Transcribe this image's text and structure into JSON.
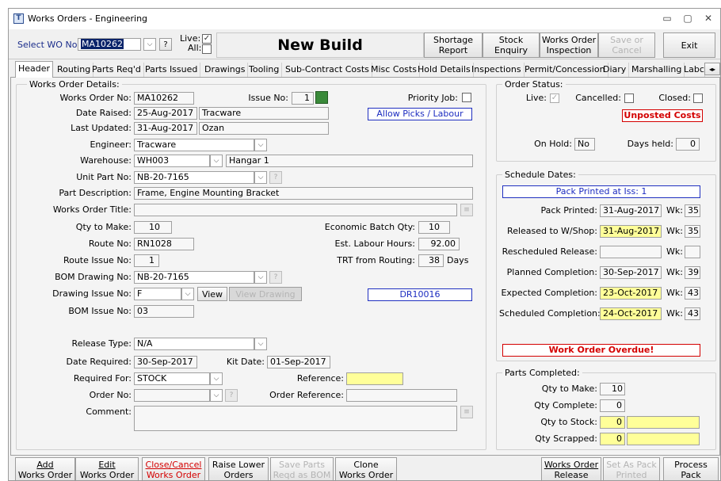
{
  "window": {
    "title": "Works Orders - Engineering",
    "min": "▭",
    "max": "▢",
    "close": "✕"
  },
  "toolbar": {
    "select_label": "Select WO No:",
    "wo_no": "MA10262",
    "help": "?",
    "live_label": "Live:",
    "all_label": "All:",
    "heading": "New Build",
    "shortage_report": [
      "Shortage",
      "Report"
    ],
    "stock_enquiry": [
      "Stock",
      "Enquiry"
    ],
    "wo_inspection": [
      "Works Order",
      "Inspection"
    ],
    "save_or_cancel": [
      "Save or",
      "Cancel"
    ],
    "exit": "Exit"
  },
  "tabs": [
    "Header",
    "Routing",
    "Parts Req'd",
    "Parts Issued",
    "Drawings",
    "Tooling",
    "Sub-Contract Costs",
    "Misc Costs",
    "Hold Details",
    "Inspections",
    "Permit/Concession",
    "Diary",
    "Marshalling",
    "Labc"
  ],
  "details": {
    "group_title": "Works Order Details:",
    "wo_no_label": "Works Order No:",
    "wo_no": "MA10262",
    "issue_no_label": "Issue No:",
    "issue_no": "1",
    "priority_label": "Priority Job:",
    "date_raised_label": "Date Raised:",
    "date_raised": "25-Aug-2017",
    "raised_by": "Tracware",
    "allow_picks": "Allow Picks / Labour",
    "last_updated_label": "Last Updated:",
    "last_updated": "31-Aug-2017",
    "updated_by": "Ozan",
    "engineer_label": "Engineer:",
    "engineer": "Tracware",
    "warehouse_label": "Warehouse:",
    "warehouse": "WH003",
    "warehouse_name": "Hangar 1",
    "unit_part_label": "Unit Part No:",
    "unit_part": "NB-20-7165",
    "part_desc_label": "Part Description:",
    "part_desc": "Frame, Engine Mounting Bracket",
    "wo_title_label": "Works Order Title:",
    "wo_title": "",
    "qty_label": "Qty to Make:",
    "qty": "10",
    "eco_batch_label": "Economic Batch Qty:",
    "eco_batch": "10",
    "route_label": "Route No:",
    "route": "RN1028",
    "labour_label": "Est. Labour Hours:",
    "labour": "92.00",
    "route_issue_label": "Route Issue No:",
    "route_issue": "1",
    "trt_label": "TRT from Routing:",
    "trt": "38",
    "days": "Days",
    "bom_drawing_label": "BOM Drawing No:",
    "bom_drawing": "NB-20-7165",
    "drawing_issue_label": "Drawing Issue No:",
    "drawing_issue": "F",
    "view": "View",
    "view_drawing": "View Drawing",
    "dr_no": "DR10016",
    "bom_issue_label": "BOM Issue No:",
    "bom_issue": "03",
    "release_type_label": "Release Type:",
    "release_type": "N/A",
    "date_required_label": "Date Required:",
    "date_required": "30-Sep-2017",
    "kit_date_label": "Kit Date:",
    "kit_date": "01-Sep-2017",
    "required_for_label": "Required For:",
    "required_for": "STOCK",
    "reference_label": "Reference:",
    "reference": "",
    "order_no_label": "Order No:",
    "order_no": "",
    "order_ref_label": "Order Reference:",
    "order_ref": "",
    "comment_label": "Comment:",
    "comment": ""
  },
  "status": {
    "group_title": "Order Status:",
    "live_label": "Live:",
    "cancelled_label": "Cancelled:",
    "closed_label": "Closed:",
    "unposted": "Unposted Costs",
    "on_hold_label": "On Hold:",
    "on_hold": "No",
    "days_held_label": "Days held:",
    "days_held": "0"
  },
  "schedule": {
    "group_title": "Schedule Dates:",
    "pack_printed_banner": "Pack Printed at Iss: 1",
    "wk_label": "Wk:",
    "rows": [
      {
        "label": "Pack Printed:",
        "date": "31-Aug-2017",
        "wk": "35",
        "hl": false
      },
      {
        "label": "Released to W/Shop:",
        "date": "31-Aug-2017",
        "wk": "35",
        "hl": true
      },
      {
        "label": "Rescheduled Release:",
        "date": "",
        "wk": "",
        "hl": false
      },
      {
        "label": "Planned Completion:",
        "date": "30-Sep-2017",
        "wk": "39",
        "hl": false
      },
      {
        "label": "Expected Completion:",
        "date": "23-Oct-2017",
        "wk": "43",
        "hl": true
      },
      {
        "label": "Scheduled Completion:",
        "date": "24-Oct-2017",
        "wk": "43",
        "hl": true
      }
    ],
    "overdue": "Work Order Overdue!"
  },
  "parts": {
    "group_title": "Parts Completed:",
    "qty_make_label": "Qty to Make:",
    "qty_make": "10",
    "qty_complete_label": "Qty Complete:",
    "qty_complete": "0",
    "qty_stock_label": "Qty to Stock:",
    "qty_stock": "0",
    "qty_scrapped_label": "Qty Scrapped:",
    "qty_scrapped": "0"
  },
  "bottom": {
    "add": [
      "Add",
      "Works Order"
    ],
    "edit": [
      "Edit",
      "Works Order"
    ],
    "close_cancel": [
      "Close/Cancel",
      "Works Order"
    ],
    "raise_lower": [
      "Raise Lower",
      "Orders"
    ],
    "save_parts": [
      "Save Parts",
      "Reqd as BOM"
    ],
    "clone": [
      "Clone",
      "Works Order"
    ],
    "wo_release": [
      "Works Order",
      "Release"
    ],
    "set_pack": [
      "Set As Pack",
      "Printed"
    ],
    "process_pack": [
      "Process",
      "Pack"
    ]
  },
  "colors": {
    "yellow": "#ffff99",
    "red": "#d40000",
    "blue": "#1c2cc0"
  }
}
